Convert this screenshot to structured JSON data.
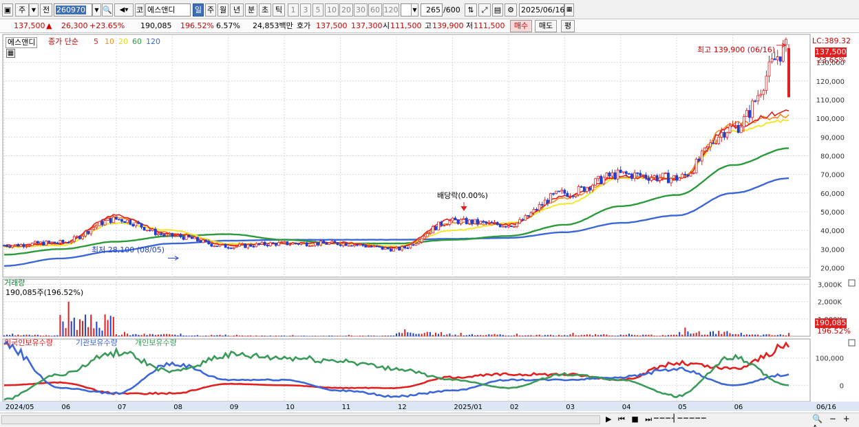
{
  "toolbar": {
    "market_btn": "주",
    "prev_btn": "전",
    "code": "260970",
    "name_prefix": "코",
    "stock_name": "에스앤디",
    "periods": [
      "일",
      "주",
      "월",
      "년",
      "분",
      "초",
      "틱"
    ],
    "active_period": "일",
    "intervals": [
      "1",
      "3",
      "5",
      "10",
      "20",
      "30",
      "60",
      "120"
    ],
    "count": "265",
    "count_total": "/600",
    "date": "2025/06/16"
  },
  "quote": {
    "price": "137,500",
    "change_arrow": "▲",
    "change": "26,300",
    "change_pct": "+23.65%",
    "volume": "190,085",
    "volume_ratio": "196.52%",
    "turnover": "6.57%",
    "amount": "24,853백만",
    "bid_label": "호가",
    "ask_price": "137,500",
    "bid_price": "137,300",
    "open_label": "시",
    "open": "111,500",
    "high_label": "고",
    "high": "139,900",
    "low_label": "저",
    "low": "111,500",
    "buy_btn": "매수",
    "sell_btn": "매도",
    "avg_btn": "평"
  },
  "price_panel": {
    "name_tag": "에스앤디",
    "ma_title": "종가 단순",
    "ma_periods": [
      "5",
      "10",
      "20",
      "60",
      "120"
    ],
    "lc_label": "LC:389.32",
    "current_price_tag": "137,500",
    "current_pct_tag": "23.65%",
    "high_annotation": "최고 139,900 (06/16)",
    "low_annotation": "최저 28,100 (08/05)",
    "dividend_annotation": "배당락(0.00%)"
  },
  "volume_panel": {
    "title": "거래량",
    "readout": "190,085주(196.52%)",
    "y_labels": [
      "3,000K",
      "2,000K",
      "1,000K"
    ],
    "last_tag": "190,085",
    "ratio_tag": "196.52%"
  },
  "holdings_panel": {
    "series_labels": [
      "외국인보유수량",
      "기관보유수량",
      "개인보유수량"
    ],
    "y_labels": [
      "100,000",
      "0"
    ]
  },
  "x_axis": {
    "labels": [
      "2024/05",
      "06",
      "07",
      "08",
      "09",
      "10",
      "11",
      "12",
      "2025/01",
      "02",
      "03",
      "04",
      "05",
      "06",
      "06/16"
    ]
  },
  "colors": {
    "up": "#e31e1e",
    "down": "#1f3fd0",
    "ma5": "#e31e1e",
    "ma10": "#f08c1e",
    "ma20": "#f2e62a",
    "ma60": "#2a9a3a",
    "ma120": "#3a66d8",
    "foreign": "#e31e1e",
    "institution": "#3a66d8",
    "individual": "#3a9a5a"
  },
  "chart_data": [
    {
      "type": "line",
      "title": "에스앤디",
      "ylabel": "",
      "ylim": [
        15000,
        145000
      ],
      "y_ticks": [
        20000,
        30000,
        40000,
        50000,
        60000,
        70000,
        80000,
        90000,
        100000,
        110000,
        120000,
        130000
      ],
      "x": [
        "2024/05",
        "06",
        "07",
        "08",
        "09",
        "10",
        "11",
        "12",
        "2025/01",
        "02",
        "03",
        "04",
        "05",
        "06",
        "06/16"
      ],
      "series": [
        {
          "name": "종가",
          "values": [
            32000,
            33500,
            46000,
            37000,
            31500,
            33000,
            33000,
            30000,
            45000,
            43000,
            60000,
            70000,
            68000,
            95000,
            137500
          ]
        },
        {
          "name": "5",
          "values": [
            32000,
            33000,
            48000,
            38000,
            32000,
            33000,
            33500,
            30500,
            46000,
            43000,
            58000,
            69000,
            67000,
            96000,
            104000
          ]
        },
        {
          "name": "10",
          "values": [
            31500,
            33000,
            47000,
            38500,
            32500,
            33000,
            33500,
            31000,
            44000,
            43000,
            57000,
            69000,
            68000,
            97000,
            102000
          ]
        },
        {
          "name": "20",
          "values": [
            31000,
            32000,
            44000,
            40000,
            33000,
            33000,
            33000,
            31500,
            40000,
            44000,
            54000,
            68000,
            68000,
            93000,
            99000
          ]
        },
        {
          "name": "60",
          "values": [
            27000,
            30000,
            34000,
            37000,
            38000,
            35000,
            33000,
            33000,
            35000,
            37000,
            43000,
            53000,
            59000,
            75000,
            84000
          ]
        },
        {
          "name": "120",
          "values": [
            21000,
            25000,
            29000,
            33000,
            34500,
            35000,
            35000,
            35000,
            35500,
            36000,
            39000,
            44000,
            48000,
            60000,
            68000
          ]
        }
      ]
    },
    {
      "type": "bar",
      "title": "거래량",
      "ylim": [
        0,
        3300000
      ],
      "categories": [
        "2024/05",
        "06",
        "07",
        "08",
        "09",
        "10",
        "11",
        "12",
        "2025/01",
        "02",
        "03",
        "04",
        "05",
        "06",
        "06/16"
      ],
      "values": [
        150000,
        2000000,
        250000,
        150000,
        80000,
        70000,
        80000,
        400000,
        200000,
        150000,
        200000,
        150000,
        500000,
        200000,
        190085
      ]
    },
    {
      "type": "line",
      "title": "보유수량",
      "ylim": [
        -60000,
        170000
      ],
      "x": [
        "2024/05",
        "06",
        "07",
        "08",
        "09",
        "10",
        "11",
        "12",
        "2025/01",
        "02",
        "03",
        "04",
        "05",
        "06",
        "06/16"
      ],
      "series": [
        {
          "name": "외국인보유수량",
          "values": [
            0,
            10000,
            -30000,
            -30000,
            5000,
            0,
            -10000,
            -10000,
            30000,
            40000,
            40000,
            20000,
            80000,
            60000,
            140000
          ]
        },
        {
          "name": "기관보유수량",
          "values": [
            150000,
            -10000,
            -30000,
            80000,
            20000,
            20000,
            -20000,
            -40000,
            -20000,
            20000,
            20000,
            30000,
            60000,
            0,
            40000
          ]
        },
        {
          "name": "개인보유수량",
          "values": [
            -50000,
            40000,
            120000,
            50000,
            110000,
            100000,
            90000,
            60000,
            20000,
            -10000,
            40000,
            20000,
            -40000,
            100000,
            0
          ]
        }
      ]
    }
  ]
}
